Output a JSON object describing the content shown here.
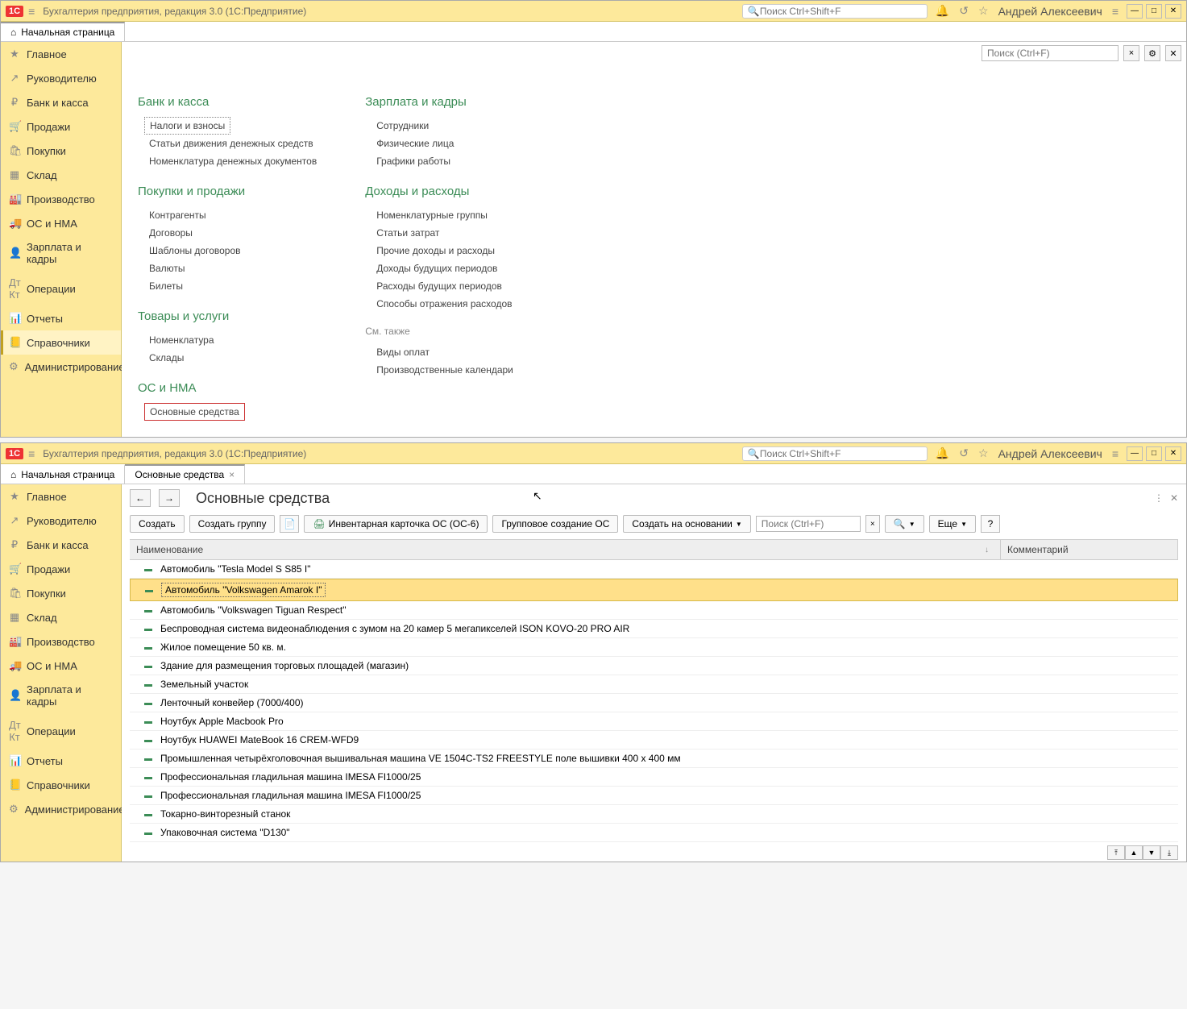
{
  "app_title": "Бухгалтерия предприятия, редакция 3.0  (1С:Предприятие)",
  "search_placeholder": "Поиск Ctrl+Shift+F",
  "user_name": "Андрей Алексеевич",
  "sidebar": {
    "items": [
      {
        "label": "Главное",
        "icon": "★"
      },
      {
        "label": "Руководителю",
        "icon": "↗"
      },
      {
        "label": "Банк и касса",
        "icon": "₽"
      },
      {
        "label": "Продажи",
        "icon": "🛒"
      },
      {
        "label": "Покупки",
        "icon": "🛍"
      },
      {
        "label": "Склад",
        "icon": "▦"
      },
      {
        "label": "Производство",
        "icon": "🏭"
      },
      {
        "label": "ОС и НМА",
        "icon": "🚚"
      },
      {
        "label": "Зарплата и кадры",
        "icon": "👤"
      },
      {
        "label": "Операции",
        "icon": "Дт Кт"
      },
      {
        "label": "Отчеты",
        "icon": "📊"
      },
      {
        "label": "Справочники",
        "icon": "📒"
      },
      {
        "label": "Администрирование",
        "icon": "⚙"
      }
    ]
  },
  "tab_home": "Начальная страница",
  "content1": {
    "search_placeholder": "Поиск (Ctrl+F)",
    "sections_left": [
      {
        "title": "Банк и касса",
        "links": [
          "Налоги и взносы",
          "Статьи движения денежных средств",
          "Номенклатура денежных документов"
        ]
      },
      {
        "title": "Покупки и продажи",
        "links": [
          "Контрагенты",
          "Договоры",
          "Шаблоны договоров",
          "Валюты",
          "Билеты"
        ]
      },
      {
        "title": "Товары и услуги",
        "links": [
          "Номенклатура",
          "Склады"
        ]
      },
      {
        "title": "ОС и НМА",
        "links": [
          "Основные средства"
        ]
      }
    ],
    "sections_right": [
      {
        "title": "Зарплата и кадры",
        "links": [
          "Сотрудники",
          "Физические лица",
          "Графики работы"
        ]
      },
      {
        "title": "Доходы и расходы",
        "links": [
          "Номенклатурные группы",
          "Статьи затрат",
          "Прочие доходы и расходы",
          "Доходы будущих периодов",
          "Расходы будущих периодов",
          "Способы отражения расходов"
        ]
      }
    ],
    "see_also_label": "См. также",
    "see_also_links": [
      "Виды оплат",
      "Производственные календари"
    ]
  },
  "window2": {
    "tab2_label": "Основные средства",
    "page_title": "Основные средства",
    "toolbar": {
      "create": "Создать",
      "create_group": "Создать группу",
      "inventory_card": "Инвентарная карточка ОС (ОС-6)",
      "group_create": "Групповое создание ОС",
      "create_based": "Создать на основании",
      "search_placeholder": "Поиск (Ctrl+F)",
      "more": "Еще"
    },
    "columns": {
      "name": "Наименование",
      "comment": "Комментарий"
    },
    "rows": [
      "Автомобиль \"Tesla Model S S85 I\"",
      "Автомобиль \"Volkswagen Amarok I\"",
      "Автомобиль \"Volkswagen Tiguan Respect\"",
      "Беспроводная система видеонаблюдения с зумом на 20 камер 5 мегапикселей ISON KOVO-20 PRO AIR",
      "Жилое помещение 50 кв. м.",
      "Здание для размещения торговых площадей (магазин)",
      "Земельный участок",
      "Ленточный конвейер (7000/400)",
      "Ноутбук Apple Macbook Pro",
      "Ноутбук HUAWEI MateBook 16 CREM-WFD9",
      "Промышленная четырёхголовочная вышивальная машина VE 1504C-TS2 FREESTYLE поле вышивки 400 x 400 мм",
      "Профессиональная гладильная машина IMESA FI1000/25",
      "Профессиональная гладильная машина IMESA FI1000/25",
      "Токарно-винторезный станок",
      "Упаковочная система \"D130\""
    ],
    "selected_row_index": 1
  }
}
